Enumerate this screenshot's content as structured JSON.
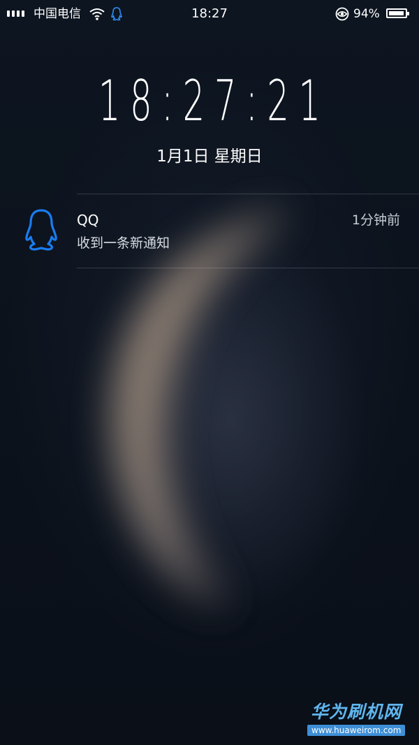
{
  "status_bar": {
    "carrier": "中国电信",
    "time": "18:27",
    "battery_percent": "94%",
    "battery_level": 0.94,
    "icons": [
      "signal-icon",
      "wifi-icon",
      "qq-icon",
      "eye-icon",
      "battery-icon"
    ]
  },
  "lockscreen": {
    "clock": "18:27:21",
    "date": "1月1日  星期日"
  },
  "notification": {
    "app_icon": "qq-penguin-icon",
    "app_name": "QQ",
    "message": "收到一条新通知",
    "time": "1分钟前",
    "accent_color": "#1a7cf0"
  },
  "watermark": {
    "title": "华为刷机网",
    "url": "www.huaweirom.com"
  }
}
